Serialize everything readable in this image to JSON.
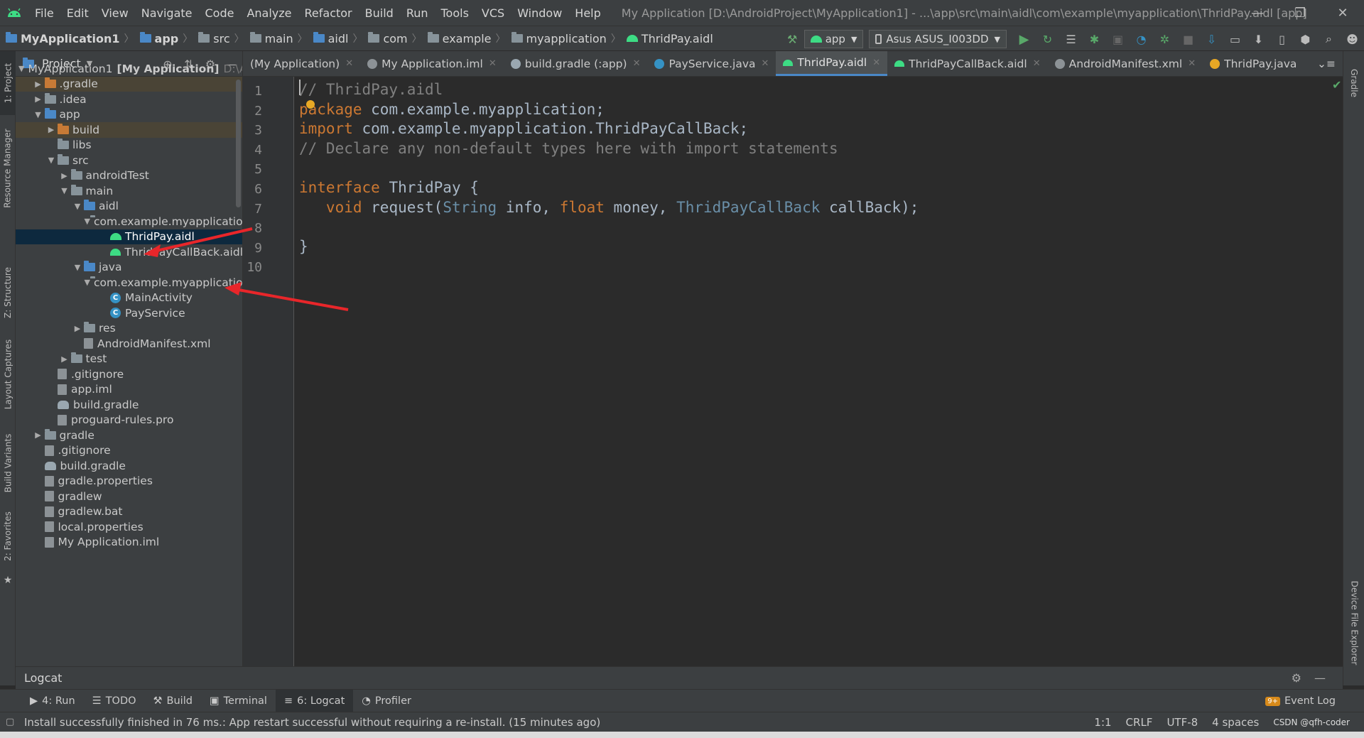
{
  "menubar": {
    "items": [
      "File",
      "Edit",
      "View",
      "Navigate",
      "Code",
      "Analyze",
      "Refactor",
      "Build",
      "Run",
      "Tools",
      "VCS",
      "Window",
      "Help"
    ],
    "window_title": "My Application [D:\\AndroidProject\\MyApplication1] - ...\\app\\src\\main\\aidl\\com\\example\\myapplication\\ThridPay.aidl [app]"
  },
  "breadcrumb": [
    "MyApplication1",
    "app",
    "src",
    "main",
    "aidl",
    "com",
    "example",
    "myapplication",
    "ThridPay.aidl"
  ],
  "toolbar": {
    "run_config": "app",
    "device": "Asus ASUS_I003DD"
  },
  "left_strip": {
    "project": "1: Project",
    "resource_manager": "Resource Manager",
    "structure": "Z: Structure",
    "layout_captures": "Layout Captures",
    "build_variants": "Build Variants",
    "favorites": "2: Favorites"
  },
  "right_strip": {
    "gradle": "Gradle",
    "device_file_explorer": "Device File Explorer"
  },
  "project_panel": {
    "title": "Project",
    "tree": [
      {
        "label": "MyApplication1",
        "extra_bold": "[My Application]",
        "dim": "D:\\AndroidP",
        "depth": 0,
        "arrow": "▼",
        "icon": "folder-blue"
      },
      {
        "label": ".gradle",
        "depth": 1,
        "arrow": "▶",
        "icon": "folder-orange",
        "hl": true
      },
      {
        "label": ".idea",
        "depth": 1,
        "arrow": "▶",
        "icon": "folder"
      },
      {
        "label": "app",
        "depth": 1,
        "arrow": "▼",
        "icon": "folder-blue"
      },
      {
        "label": "build",
        "depth": 2,
        "arrow": "▶",
        "icon": "folder-orange",
        "hl": true
      },
      {
        "label": "libs",
        "depth": 2,
        "arrow": "",
        "icon": "folder"
      },
      {
        "label": "src",
        "depth": 2,
        "arrow": "▼",
        "icon": "folder"
      },
      {
        "label": "androidTest",
        "depth": 3,
        "arrow": "▶",
        "icon": "folder"
      },
      {
        "label": "main",
        "depth": 3,
        "arrow": "▼",
        "icon": "folder"
      },
      {
        "label": "aidl",
        "depth": 4,
        "arrow": "▼",
        "icon": "folder-blue"
      },
      {
        "label": "com.example.myapplication",
        "depth": 5,
        "arrow": "▼",
        "icon": "folder"
      },
      {
        "label": "ThridPay.aidl",
        "depth": 6,
        "arrow": "",
        "icon": "droid",
        "selected": true
      },
      {
        "label": "ThridPayCallBack.aidl",
        "depth": 6,
        "arrow": "",
        "icon": "droid"
      },
      {
        "label": "java",
        "depth": 4,
        "arrow": "▼",
        "icon": "folder-blue"
      },
      {
        "label": "com.example.myapplication",
        "depth": 5,
        "arrow": "▼",
        "icon": "folder"
      },
      {
        "label": "MainActivity",
        "depth": 6,
        "arrow": "",
        "icon": "class"
      },
      {
        "label": "PayService",
        "depth": 6,
        "arrow": "",
        "icon": "class"
      },
      {
        "label": "res",
        "depth": 4,
        "arrow": "▶",
        "icon": "folder"
      },
      {
        "label": "AndroidManifest.xml",
        "depth": 4,
        "arrow": "",
        "icon": "file"
      },
      {
        "label": "test",
        "depth": 3,
        "arrow": "▶",
        "icon": "folder"
      },
      {
        "label": ".gitignore",
        "depth": 2,
        "arrow": "",
        "icon": "file"
      },
      {
        "label": "app.iml",
        "depth": 2,
        "arrow": "",
        "icon": "file"
      },
      {
        "label": "build.gradle",
        "depth": 2,
        "arrow": "",
        "icon": "gradle"
      },
      {
        "label": "proguard-rules.pro",
        "depth": 2,
        "arrow": "",
        "icon": "file"
      },
      {
        "label": "gradle",
        "depth": 1,
        "arrow": "▶",
        "icon": "folder"
      },
      {
        "label": ".gitignore",
        "depth": 1,
        "arrow": "",
        "icon": "file"
      },
      {
        "label": "build.gradle",
        "depth": 1,
        "arrow": "",
        "icon": "gradle"
      },
      {
        "label": "gradle.properties",
        "depth": 1,
        "arrow": "",
        "icon": "file"
      },
      {
        "label": "gradlew",
        "depth": 1,
        "arrow": "",
        "icon": "file"
      },
      {
        "label": "gradlew.bat",
        "depth": 1,
        "arrow": "",
        "icon": "file"
      },
      {
        "label": "local.properties",
        "depth": 1,
        "arrow": "",
        "icon": "file"
      },
      {
        "label": "My Application.iml",
        "depth": 1,
        "arrow": "",
        "icon": "file"
      }
    ]
  },
  "editor_tabs": [
    {
      "label": "(My Application)",
      "icon": "none"
    },
    {
      "label": "My Application.iml",
      "icon": "file"
    },
    {
      "label": "build.gradle (:app)",
      "icon": "gradle"
    },
    {
      "label": "PayService.java",
      "icon": "class"
    },
    {
      "label": "ThridPay.aidl",
      "icon": "droid",
      "active": true
    },
    {
      "label": "ThridPayCallBack.aidl",
      "icon": "droid"
    },
    {
      "label": "AndroidManifest.xml",
      "icon": "file"
    },
    {
      "label": "ThridPay.java",
      "icon": "java"
    }
  ],
  "editor": {
    "line_numbers": [
      "1",
      "2",
      "3",
      "4",
      "5",
      "6",
      "7",
      "8",
      "9",
      "10"
    ],
    "lines": [
      [
        {
          "t": "// ThridPay.aidl",
          "c": "cmt"
        }
      ],
      [
        {
          "t": "package",
          "c": "kw"
        },
        {
          "t": " com.example.myapplication;",
          "c": ""
        }
      ],
      [
        {
          "t": "import",
          "c": "kw"
        },
        {
          "t": " com.example.myapplication.ThridPayCallBack;",
          "c": ""
        }
      ],
      [
        {
          "t": "// Declare any non-default types here with import statements",
          "c": "cmt"
        }
      ],
      [],
      [
        {
          "t": "interface",
          "c": "kw"
        },
        {
          "t": " ThridPay {",
          "c": ""
        }
      ],
      [
        {
          "t": "   void",
          "c": "kw"
        },
        {
          "t": " request(",
          "c": ""
        },
        {
          "t": "String",
          "c": "type2"
        },
        {
          "t": " info, ",
          "c": ""
        },
        {
          "t": "float",
          "c": "kw"
        },
        {
          "t": " money, ",
          "c": ""
        },
        {
          "t": "ThridPayCallBack",
          "c": "type2"
        },
        {
          "t": " callBack);",
          "c": ""
        }
      ],
      [],
      [
        {
          "t": "}",
          "c": ""
        }
      ],
      []
    ]
  },
  "logcat": {
    "title": "Logcat"
  },
  "bottom_tabs": [
    {
      "label": "4: Run",
      "icon": "▶"
    },
    {
      "label": "TODO",
      "icon": "☰"
    },
    {
      "label": "Build",
      "icon": "⚒"
    },
    {
      "label": "Terminal",
      "icon": "▣"
    },
    {
      "label": "6: Logcat",
      "icon": "≡",
      "active": true
    },
    {
      "label": "Profiler",
      "icon": "◔"
    }
  ],
  "event_log": "Event Log",
  "status": {
    "message": "Install successfully finished in 76 ms.: App restart successful without requiring a re-install. (15 minutes ago)",
    "position": "1:1",
    "line_sep": "CRLF",
    "encoding": "UTF-8",
    "indent": "4 spaces",
    "watermark": "CSDN @qfh-coder"
  },
  "colors": {
    "keyword": "#cc7832",
    "comment": "#808080",
    "type": "#6a8fa8",
    "annotation_arrow": "#e8262a"
  }
}
